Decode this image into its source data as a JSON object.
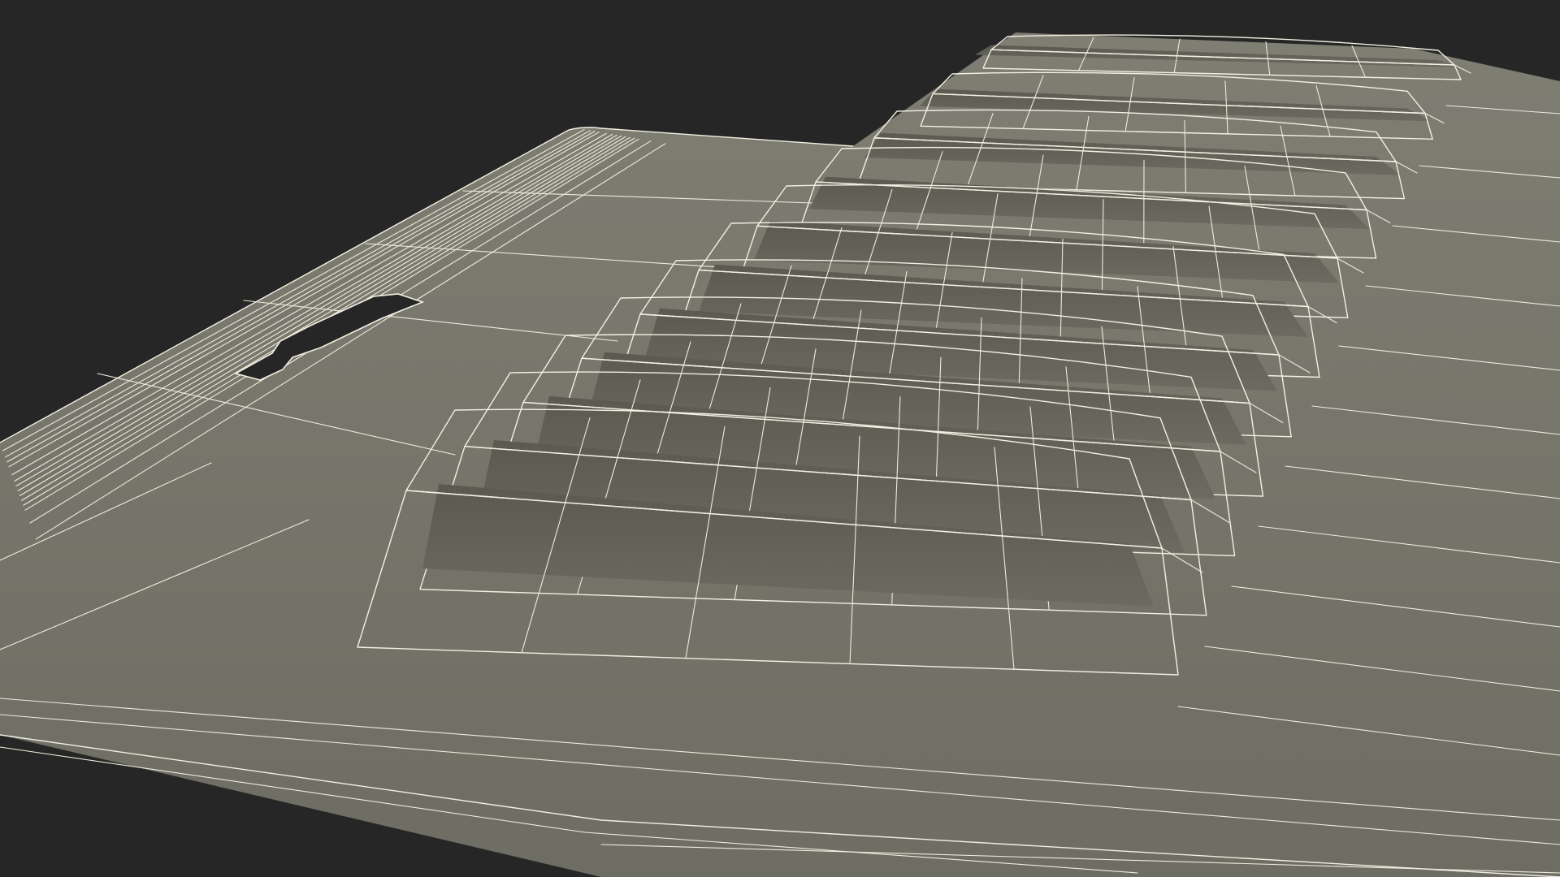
{
  "scene": {
    "background_color": "#262626",
    "surface_color": "#7b7b70",
    "surface_shadow_color": "#5f5f56",
    "wire_color": "#f3f0e2",
    "rib_count": 11,
    "slot_count": 1
  }
}
